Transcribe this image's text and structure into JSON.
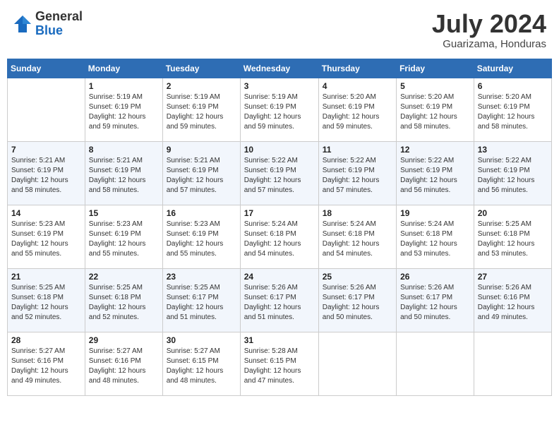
{
  "header": {
    "logo_general": "General",
    "logo_blue": "Blue",
    "month_year": "July 2024",
    "location": "Guarizama, Honduras"
  },
  "days_of_week": [
    "Sunday",
    "Monday",
    "Tuesday",
    "Wednesday",
    "Thursday",
    "Friday",
    "Saturday"
  ],
  "weeks": [
    [
      {
        "day": "",
        "sunrise": "",
        "sunset": "",
        "daylight": ""
      },
      {
        "day": "1",
        "sunrise": "5:19 AM",
        "sunset": "6:19 PM",
        "daylight": "12 hours and 59 minutes."
      },
      {
        "day": "2",
        "sunrise": "5:19 AM",
        "sunset": "6:19 PM",
        "daylight": "12 hours and 59 minutes."
      },
      {
        "day": "3",
        "sunrise": "5:19 AM",
        "sunset": "6:19 PM",
        "daylight": "12 hours and 59 minutes."
      },
      {
        "day": "4",
        "sunrise": "5:20 AM",
        "sunset": "6:19 PM",
        "daylight": "12 hours and 59 minutes."
      },
      {
        "day": "5",
        "sunrise": "5:20 AM",
        "sunset": "6:19 PM",
        "daylight": "12 hours and 58 minutes."
      },
      {
        "day": "6",
        "sunrise": "5:20 AM",
        "sunset": "6:19 PM",
        "daylight": "12 hours and 58 minutes."
      }
    ],
    [
      {
        "day": "7",
        "sunrise": "5:21 AM",
        "sunset": "6:19 PM",
        "daylight": "12 hours and 58 minutes."
      },
      {
        "day": "8",
        "sunrise": "5:21 AM",
        "sunset": "6:19 PM",
        "daylight": "12 hours and 58 minutes."
      },
      {
        "day": "9",
        "sunrise": "5:21 AM",
        "sunset": "6:19 PM",
        "daylight": "12 hours and 57 minutes."
      },
      {
        "day": "10",
        "sunrise": "5:22 AM",
        "sunset": "6:19 PM",
        "daylight": "12 hours and 57 minutes."
      },
      {
        "day": "11",
        "sunrise": "5:22 AM",
        "sunset": "6:19 PM",
        "daylight": "12 hours and 57 minutes."
      },
      {
        "day": "12",
        "sunrise": "5:22 AM",
        "sunset": "6:19 PM",
        "daylight": "12 hours and 56 minutes."
      },
      {
        "day": "13",
        "sunrise": "5:22 AM",
        "sunset": "6:19 PM",
        "daylight": "12 hours and 56 minutes."
      }
    ],
    [
      {
        "day": "14",
        "sunrise": "5:23 AM",
        "sunset": "6:19 PM",
        "daylight": "12 hours and 55 minutes."
      },
      {
        "day": "15",
        "sunrise": "5:23 AM",
        "sunset": "6:19 PM",
        "daylight": "12 hours and 55 minutes."
      },
      {
        "day": "16",
        "sunrise": "5:23 AM",
        "sunset": "6:19 PM",
        "daylight": "12 hours and 55 minutes."
      },
      {
        "day": "17",
        "sunrise": "5:24 AM",
        "sunset": "6:18 PM",
        "daylight": "12 hours and 54 minutes."
      },
      {
        "day": "18",
        "sunrise": "5:24 AM",
        "sunset": "6:18 PM",
        "daylight": "12 hours and 54 minutes."
      },
      {
        "day": "19",
        "sunrise": "5:24 AM",
        "sunset": "6:18 PM",
        "daylight": "12 hours and 53 minutes."
      },
      {
        "day": "20",
        "sunrise": "5:25 AM",
        "sunset": "6:18 PM",
        "daylight": "12 hours and 53 minutes."
      }
    ],
    [
      {
        "day": "21",
        "sunrise": "5:25 AM",
        "sunset": "6:18 PM",
        "daylight": "12 hours and 52 minutes."
      },
      {
        "day": "22",
        "sunrise": "5:25 AM",
        "sunset": "6:18 PM",
        "daylight": "12 hours and 52 minutes."
      },
      {
        "day": "23",
        "sunrise": "5:25 AM",
        "sunset": "6:17 PM",
        "daylight": "12 hours and 51 minutes."
      },
      {
        "day": "24",
        "sunrise": "5:26 AM",
        "sunset": "6:17 PM",
        "daylight": "12 hours and 51 minutes."
      },
      {
        "day": "25",
        "sunrise": "5:26 AM",
        "sunset": "6:17 PM",
        "daylight": "12 hours and 50 minutes."
      },
      {
        "day": "26",
        "sunrise": "5:26 AM",
        "sunset": "6:17 PM",
        "daylight": "12 hours and 50 minutes."
      },
      {
        "day": "27",
        "sunrise": "5:26 AM",
        "sunset": "6:16 PM",
        "daylight": "12 hours and 49 minutes."
      }
    ],
    [
      {
        "day": "28",
        "sunrise": "5:27 AM",
        "sunset": "6:16 PM",
        "daylight": "12 hours and 49 minutes."
      },
      {
        "day": "29",
        "sunrise": "5:27 AM",
        "sunset": "6:16 PM",
        "daylight": "12 hours and 48 minutes."
      },
      {
        "day": "30",
        "sunrise": "5:27 AM",
        "sunset": "6:15 PM",
        "daylight": "12 hours and 48 minutes."
      },
      {
        "day": "31",
        "sunrise": "5:28 AM",
        "sunset": "6:15 PM",
        "daylight": "12 hours and 47 minutes."
      },
      {
        "day": "",
        "sunrise": "",
        "sunset": "",
        "daylight": ""
      },
      {
        "day": "",
        "sunrise": "",
        "sunset": "",
        "daylight": ""
      },
      {
        "day": "",
        "sunrise": "",
        "sunset": "",
        "daylight": ""
      }
    ]
  ],
  "labels": {
    "sunrise": "Sunrise:",
    "sunset": "Sunset:",
    "daylight": "Daylight:"
  }
}
